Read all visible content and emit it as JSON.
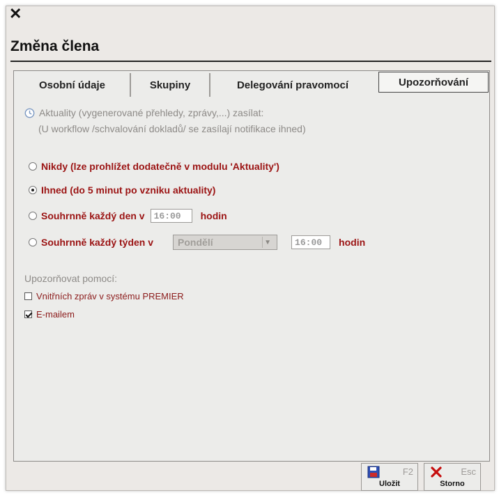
{
  "window": {
    "close_glyph": "✕",
    "title": "Změna člena"
  },
  "tabs": [
    {
      "label": "Osobní údaje"
    },
    {
      "label": "Skupiny"
    },
    {
      "label": "Delegování pravomocí"
    },
    {
      "label": "Upozorňování",
      "active": true
    }
  ],
  "info": {
    "line1": "Aktuality (vygenerované přehledy, zprávy,...) zasílat:",
    "line2": "(U workflow /schvalování dokladů/ se zasílají notifikace ihned)"
  },
  "options": {
    "never": "Nikdy (lze prohlížet dodatečně v modulu 'Aktuality')",
    "immediate": "Ihned (do 5 minut po vzniku aktuality)",
    "daily_label": "Souhrnně každý den v",
    "daily_time": "16:00",
    "daily_suffix": "hodin",
    "weekly_label": "Souhrnně každý týden v",
    "weekly_day": "Pondělí",
    "weekly_time": "16:00",
    "weekly_suffix": "hodin",
    "selected": "immediate"
  },
  "notify": {
    "heading": "Upozorňovat pomocí:",
    "internal": {
      "label": "Vnitřních zpráv v systému PREMIER",
      "checked": false
    },
    "email": {
      "label": "E-mailem",
      "checked": true
    }
  },
  "buttons": {
    "save": {
      "key": "F2",
      "label": "Uložit"
    },
    "cancel": {
      "key": "Esc",
      "label": "Storno"
    }
  },
  "colors": {
    "accent_red": "#9b1313",
    "dialog_bg": "#ece9e6"
  },
  "icons": {
    "info": "clock-icon",
    "save": "save-disk-icon",
    "cancel": "red-x-icon"
  }
}
